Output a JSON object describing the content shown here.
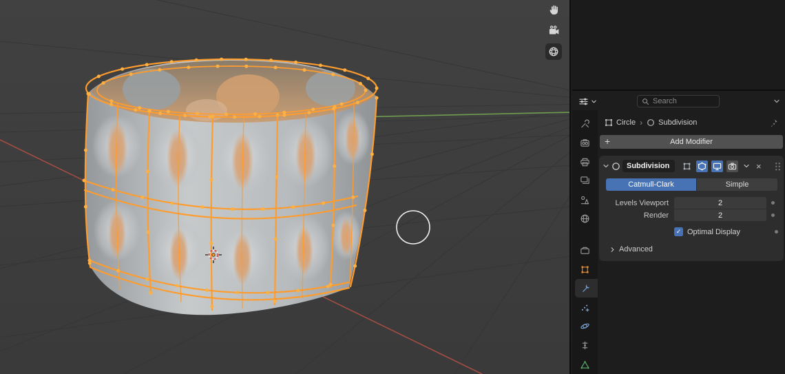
{
  "colors": {
    "accent_blue": "#4772b3",
    "selection_orange": "#ff9c2e",
    "axis_green": "#6f9e4f",
    "axis_red": "#a34d44",
    "panel_bg": "#2d2d2d",
    "editor_bg": "#1d1d1d"
  },
  "viewport": {
    "nav_gizmos": [
      "pan",
      "camera",
      "orthographic-grid"
    ],
    "selected_object": "Circle"
  },
  "properties_header": {
    "search_placeholder": "Search"
  },
  "breadcrumb": {
    "object_name": "Circle",
    "active_modifier": "Subdivision"
  },
  "add_modifier": {
    "label": "Add Modifier"
  },
  "modifier": {
    "name": "Subdivision",
    "type_options": [
      "Catmull-Clark",
      "Simple"
    ],
    "selected_type": "Catmull-Clark",
    "levels_viewport_label": "Levels Viewport",
    "levels_viewport_value": "2",
    "render_label": "Render",
    "render_value": "2",
    "optimal_display_label": "Optimal Display",
    "optimal_display_checked": true,
    "advanced_label": "Advanced"
  },
  "icons": {
    "plus": "+",
    "close": "×",
    "check": "✓",
    "breadcrumb_separator": "›"
  },
  "property_tabs": [
    {
      "id": "tool",
      "active": false
    },
    {
      "id": "render",
      "active": false
    },
    {
      "id": "output",
      "active": false
    },
    {
      "id": "view-layer",
      "active": false
    },
    {
      "id": "scene",
      "active": false
    },
    {
      "id": "world",
      "active": false
    },
    {
      "id": "collection",
      "active": false
    },
    {
      "id": "object",
      "active": false
    },
    {
      "id": "modifiers",
      "active": true
    },
    {
      "id": "particles",
      "active": false
    },
    {
      "id": "physics",
      "active": false
    },
    {
      "id": "constraints",
      "active": false
    },
    {
      "id": "object-data",
      "active": false
    }
  ]
}
